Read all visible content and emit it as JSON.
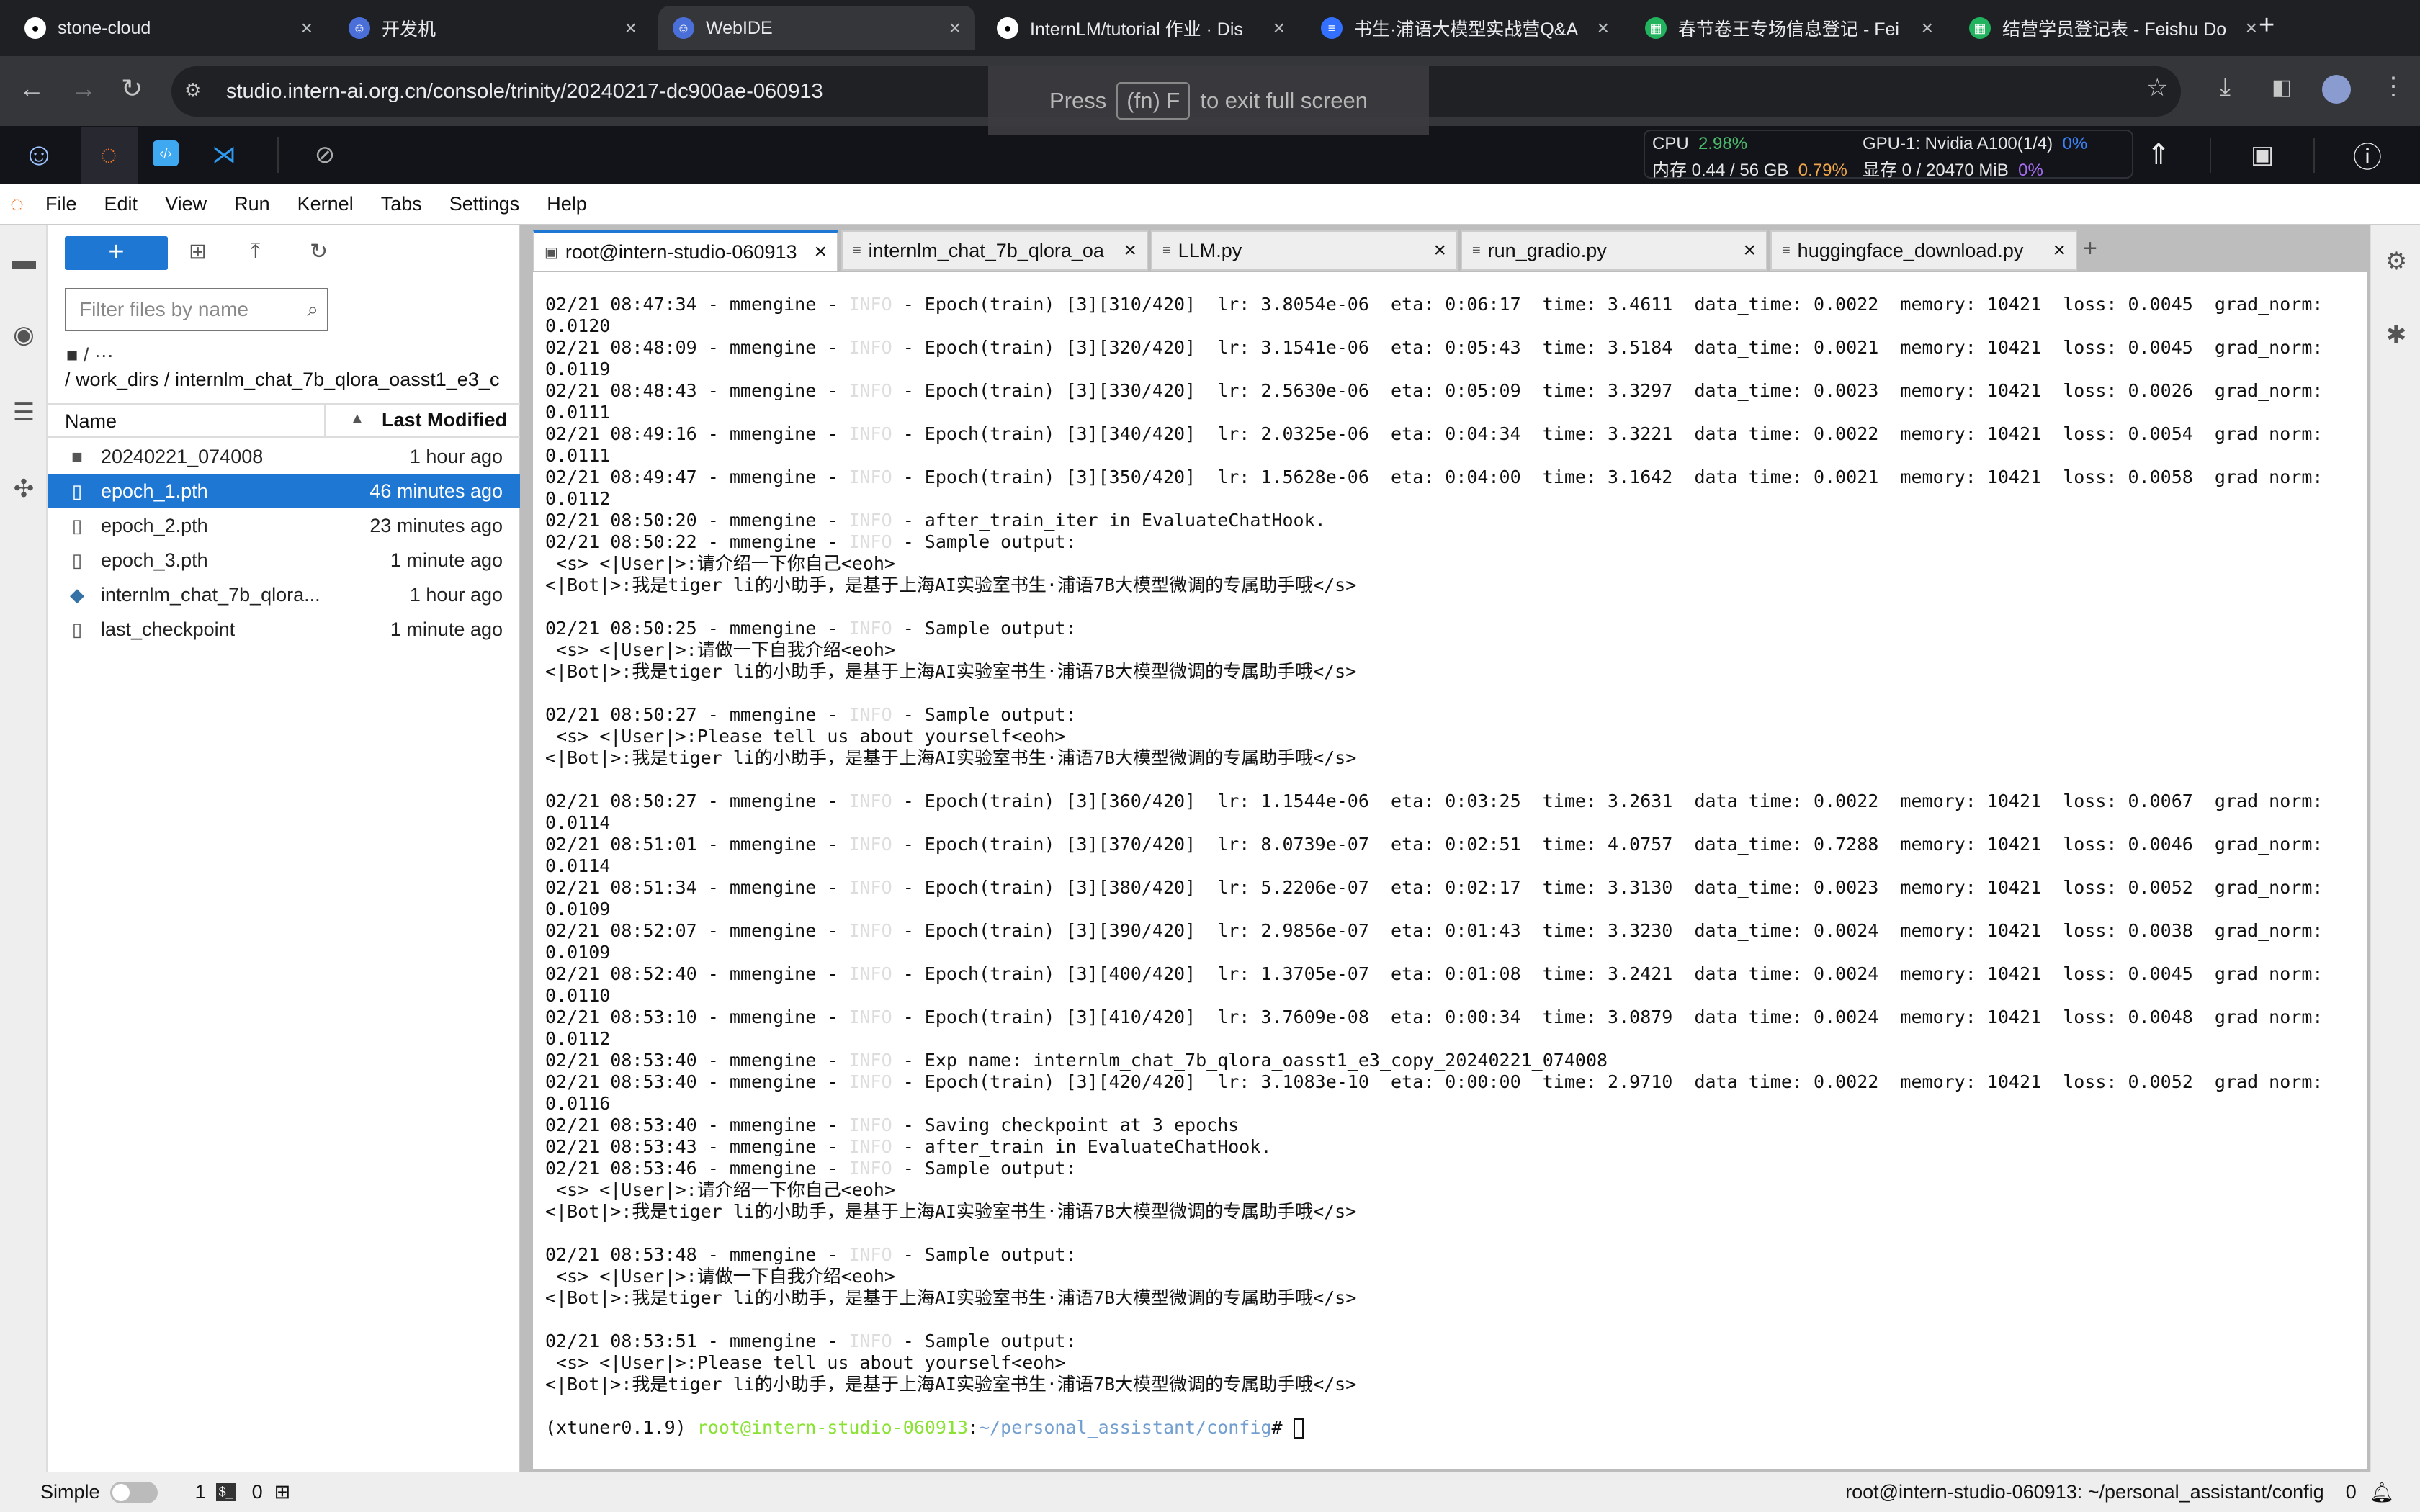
{
  "browser": {
    "tabs": [
      {
        "label": "stone-cloud",
        "icon": "github-icon"
      },
      {
        "label": "开发机",
        "icon": "intern-icon"
      },
      {
        "label": "WebIDE",
        "icon": "intern-icon",
        "active": true
      },
      {
        "label": "InternLM/tutorial 作业 · Dis",
        "icon": "github-icon"
      },
      {
        "label": "书生·浦语大模型实战营Q&A",
        "icon": "doc-icon"
      },
      {
        "label": "春节卷王专场信息登记 - Fei",
        "icon": "sheet-icon"
      },
      {
        "label": "结营学员登记表 - Feishu Do",
        "icon": "sheet-icon"
      }
    ],
    "new_tab": "+",
    "url": "studio.intern-ai.org.cn/console/trinity/20240217-dc900ae-060913",
    "fullscreen_msg": {
      "pre": "Press",
      "key": "(fn) F",
      "post": "to exit full screen"
    }
  },
  "resources": {
    "cpu_label": "CPU",
    "cpu_val": "2.98%",
    "mem_label": "内存 0.44 / 56 GB",
    "mem_val": "0.79%",
    "gpu_label": "GPU-1: Nvidia A100(1/4)",
    "gpu_val": "0%",
    "vram_label": "显存 0 / 20470 MiB",
    "vram_val": "0%",
    "colors": {
      "cpu": "#4cbb6c",
      "mem": "#f0a64b",
      "gpu": "#3b82f6",
      "vram": "#a66cf0"
    }
  },
  "menu": [
    "File",
    "Edit",
    "View",
    "Run",
    "Kernel",
    "Tabs",
    "Settings",
    "Help"
  ],
  "filebrowser": {
    "filter_placeholder": "Filter files by name",
    "crumb_root": "/  ···",
    "crumb_path": "/ work_dirs / internlm_chat_7b_qlora_oasst1_e3_c",
    "col_name": "Name",
    "col_modified": "Last Modified",
    "files": [
      {
        "name": "20240221_074008",
        "modified": "1 hour ago",
        "type": "folder"
      },
      {
        "name": "epoch_1.pth",
        "modified": "46 minutes ago",
        "type": "file",
        "selected": true
      },
      {
        "name": "epoch_2.pth",
        "modified": "23 minutes ago",
        "type": "file"
      },
      {
        "name": "epoch_3.pth",
        "modified": "1 minute ago",
        "type": "file"
      },
      {
        "name": "internlm_chat_7b_qlora...",
        "modified": "1 hour ago",
        "type": "python"
      },
      {
        "name": "last_checkpoint",
        "modified": "1 minute ago",
        "type": "file"
      }
    ]
  },
  "editor_tabs": [
    {
      "label": "root@intern-studio-060913",
      "active": true
    },
    {
      "label": "internlm_chat_7b_qlora_oa"
    },
    {
      "label": "LLM.py"
    },
    {
      "label": "run_gradio.py"
    },
    {
      "label": "huggingface_download.py"
    }
  ],
  "add_tab": "+",
  "terminal": {
    "lines": [
      [
        "02/21 08:47:34 - mmengine - ",
        "INFO",
        " - Epoch(train) [3][310/420]  lr: 3.8054e-06  eta: 0:06:17  time: 3.4611  data_time: 0.0022  memory: 10421  loss: 0.0045  grad_norm:"
      ],
      [
        "0.0120"
      ],
      [
        "02/21 08:48:09 - mmengine - ",
        "INFO",
        " - Epoch(train) [3][320/420]  lr: 3.1541e-06  eta: 0:05:43  time: 3.5184  data_time: 0.0021  memory: 10421  loss: 0.0045  grad_norm:"
      ],
      [
        "0.0119"
      ],
      [
        "02/21 08:48:43 - mmengine - ",
        "INFO",
        " - Epoch(train) [3][330/420]  lr: 2.5630e-06  eta: 0:05:09  time: 3.3297  data_time: 0.0023  memory: 10421  loss: 0.0026  grad_norm:"
      ],
      [
        "0.0111"
      ],
      [
        "02/21 08:49:16 - mmengine - ",
        "INFO",
        " - Epoch(train) [3][340/420]  lr: 2.0325e-06  eta: 0:04:34  time: 3.3221  data_time: 0.0022  memory: 10421  loss: 0.0054  grad_norm:"
      ],
      [
        "0.0111"
      ],
      [
        "02/21 08:49:47 - mmengine - ",
        "INFO",
        " - Epoch(train) [3][350/420]  lr: 1.5628e-06  eta: 0:04:00  time: 3.1642  data_time: 0.0021  memory: 10421  loss: 0.0058  grad_norm:"
      ],
      [
        "0.0112"
      ],
      [
        "02/21 08:50:20 - mmengine - ",
        "INFO",
        " - after_train_iter in EvaluateChatHook."
      ],
      [
        "02/21 08:50:22 - mmengine - ",
        "INFO",
        " - Sample output:"
      ],
      [
        " <s> <|User|>:请介绍一下你自己<eoh>"
      ],
      [
        "<|Bot|>:我是tiger li的小助手，是基于上海AI实验室书生·浦语7B大模型微调的专属助手哦</s>"
      ],
      [
        ""
      ],
      [
        "02/21 08:50:25 - mmengine - ",
        "INFO",
        " - Sample output:"
      ],
      [
        " <s> <|User|>:请做一下自我介绍<eoh>"
      ],
      [
        "<|Bot|>:我是tiger li的小助手，是基于上海AI实验室书生·浦语7B大模型微调的专属助手哦</s>"
      ],
      [
        ""
      ],
      [
        "02/21 08:50:27 - mmengine - ",
        "INFO",
        " - Sample output:"
      ],
      [
        " <s> <|User|>:Please tell us about yourself<eoh>"
      ],
      [
        "<|Bot|>:我是tiger li的小助手，是基于上海AI实验室书生·浦语7B大模型微调的专属助手哦</s>"
      ],
      [
        ""
      ],
      [
        "02/21 08:50:27 - mmengine - ",
        "INFO",
        " - Epoch(train) [3][360/420]  lr: 1.1544e-06  eta: 0:03:25  time: 3.2631  data_time: 0.0022  memory: 10421  loss: 0.0067  grad_norm:"
      ],
      [
        "0.0114"
      ],
      [
        "02/21 08:51:01 - mmengine - ",
        "INFO",
        " - Epoch(train) [3][370/420]  lr: 8.0739e-07  eta: 0:02:51  time: 4.0757  data_time: 0.7288  memory: 10421  loss: 0.0046  grad_norm:"
      ],
      [
        "0.0114"
      ],
      [
        "02/21 08:51:34 - mmengine - ",
        "INFO",
        " - Epoch(train) [3][380/420]  lr: 5.2206e-07  eta: 0:02:17  time: 3.3130  data_time: 0.0023  memory: 10421  loss: 0.0052  grad_norm:"
      ],
      [
        "0.0109"
      ],
      [
        "02/21 08:52:07 - mmengine - ",
        "INFO",
        " - Epoch(train) [3][390/420]  lr: 2.9856e-07  eta: 0:01:43  time: 3.3230  data_time: 0.0024  memory: 10421  loss: 0.0038  grad_norm:"
      ],
      [
        "0.0109"
      ],
      [
        "02/21 08:52:40 - mmengine - ",
        "INFO",
        " - Epoch(train) [3][400/420]  lr: 1.3705e-07  eta: 0:01:08  time: 3.2421  data_time: 0.0024  memory: 10421  loss: 0.0045  grad_norm:"
      ],
      [
        "0.0110"
      ],
      [
        "02/21 08:53:10 - mmengine - ",
        "INFO",
        " - Epoch(train) [3][410/420]  lr: 3.7609e-08  eta: 0:00:34  time: 3.0879  data_time: 0.0024  memory: 10421  loss: 0.0048  grad_norm:"
      ],
      [
        "0.0112"
      ],
      [
        "02/21 08:53:40 - mmengine - ",
        "INFO",
        " - Exp name: internlm_chat_7b_qlora_oasst1_e3_copy_20240221_074008"
      ],
      [
        "02/21 08:53:40 - mmengine - ",
        "INFO",
        " - Epoch(train) [3][420/420]  lr: 3.1083e-10  eta: 0:00:00  time: 2.9710  data_time: 0.0022  memory: 10421  loss: 0.0052  grad_norm:"
      ],
      [
        "0.0116"
      ],
      [
        "02/21 08:53:40 - mmengine - ",
        "INFO",
        " - Saving checkpoint at 3 epochs"
      ],
      [
        "02/21 08:53:43 - mmengine - ",
        "INFO",
        " - after_train in EvaluateChatHook."
      ],
      [
        "02/21 08:53:46 - mmengine - ",
        "INFO",
        " - Sample output:"
      ],
      [
        " <s> <|User|>:请介绍一下你自己<eoh>"
      ],
      [
        "<|Bot|>:我是tiger li的小助手，是基于上海AI实验室书生·浦语7B大模型微调的专属助手哦</s>"
      ],
      [
        ""
      ],
      [
        "02/21 08:53:48 - mmengine - ",
        "INFO",
        " - Sample output:"
      ],
      [
        " <s> <|User|>:请做一下自我介绍<eoh>"
      ],
      [
        "<|Bot|>:我是tiger li的小助手，是基于上海AI实验室书生·浦语7B大模型微调的专属助手哦</s>"
      ],
      [
        ""
      ],
      [
        "02/21 08:53:51 - mmengine - ",
        "INFO",
        " - Sample output:"
      ],
      [
        " <s> <|User|>:Please tell us about yourself<eoh>"
      ],
      [
        "<|Bot|>:我是tiger li的小助手，是基于上海AI实验室书生·浦语7B大模型微调的专属助手哦</s>"
      ],
      [
        ""
      ]
    ],
    "prompt": {
      "env": "(xtuner0.1.9) ",
      "user": "root@intern-studio-060913",
      "sep": ":",
      "path": "~/personal_assistant/config",
      "symbol": "# "
    }
  },
  "statusbar": {
    "mode": "Simple",
    "kernels": "1",
    "terminals": "0",
    "right_text": "root@intern-studio-060913: ~/personal_assistant/config",
    "notifications": "0"
  }
}
